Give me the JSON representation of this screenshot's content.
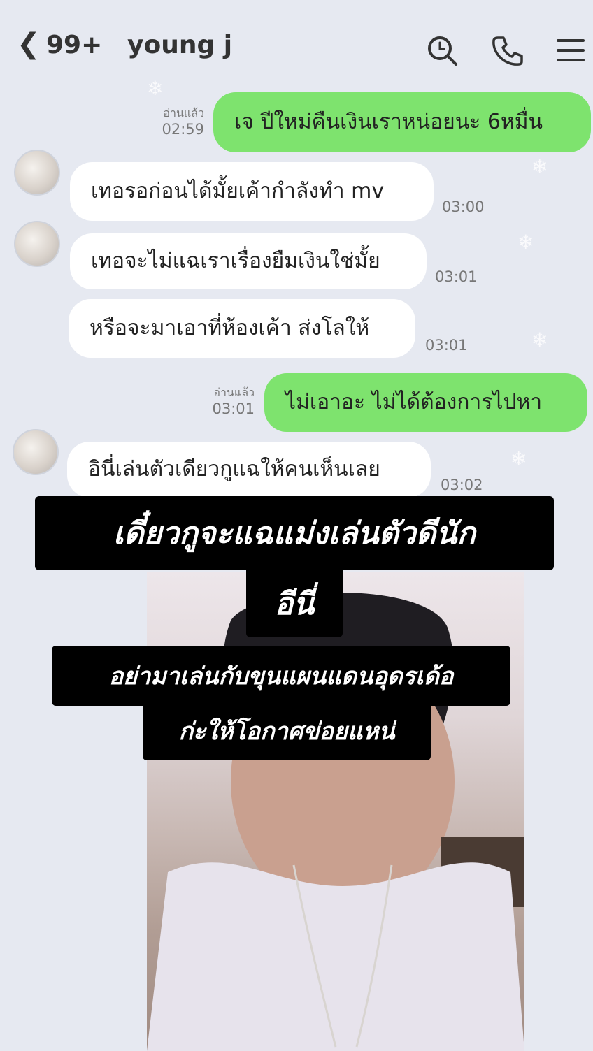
{
  "header": {
    "back_icon": "chevron-left-icon",
    "unread_count": "99+",
    "contact_name": "young j",
    "icons": [
      "search-icon",
      "phone-icon",
      "menu-icon"
    ]
  },
  "messages": [
    {
      "side": "right",
      "read_label": "อ่านแล้ว",
      "time": "02:59",
      "text": "เจ ปีใหม่คืนเงินเราหน่อยนะ 6หมื่น"
    },
    {
      "side": "left",
      "time": "03:00",
      "text": "เทอรอก่อนได้มั้ยเค้ากำลังทำ mv"
    },
    {
      "side": "left",
      "time": "03:01",
      "text": "เทอจะไม่แฉเราเรื่องยืมเงินใช่มั้ย"
    },
    {
      "side": "left",
      "time": "03:01",
      "text": "หรือจะมาเอาที่ห้องเค้า ส่งโลให้"
    },
    {
      "side": "right",
      "read_label": "อ่านแล้ว",
      "time": "03:01",
      "text": "ไม่เอาอะ ไม่ได้ต้องการไปหา"
    },
    {
      "side": "left",
      "time": "03:02",
      "text": "อินี่เล่นตัวเดียวกูแฉให้คนเห็นเลย"
    }
  ],
  "captions": {
    "line1": "เดี๋ยวกูจะแฉแม่งเล่นตัวดีนัก",
    "line2": "อีนี่",
    "line3": "อย่ามาเล่นกับขุนแผนแดนอุดรเด้อ",
    "line4": "ก่ะให้โอกาศข่อยแหน่"
  },
  "colors": {
    "background": "#e6e9f1",
    "sent_bubble": "#7ee36e",
    "received_bubble": "#ffffff",
    "caption_bg": "#000000",
    "caption_text": "#ffffff"
  }
}
